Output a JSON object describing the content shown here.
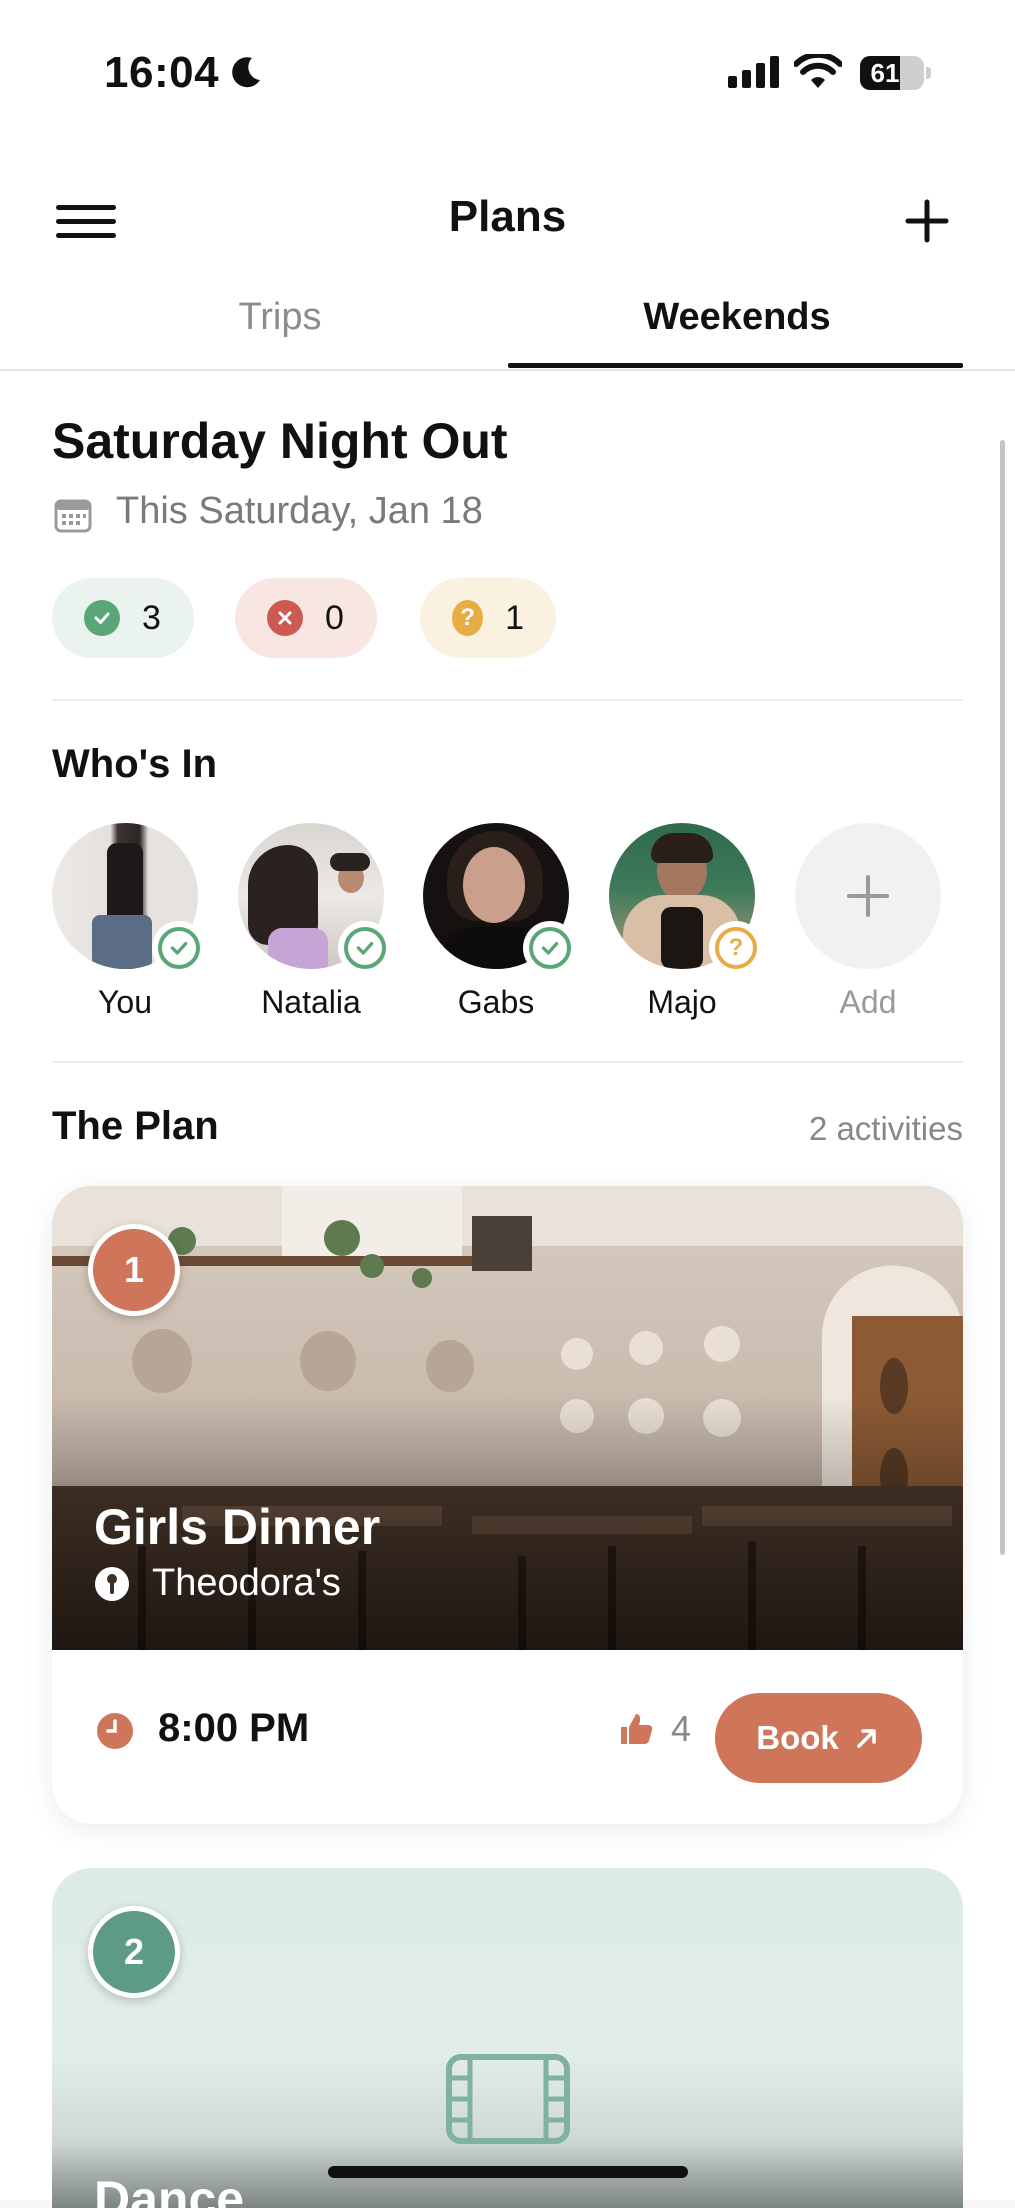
{
  "status_bar": {
    "time": "16:04",
    "battery": "61"
  },
  "header": {
    "title": "Plans"
  },
  "tabs": [
    {
      "label": "Trips",
      "active": false
    },
    {
      "label": "Weekends",
      "active": true
    }
  ],
  "event": {
    "title": "Saturday Night Out",
    "date": "This Saturday, Jan 18",
    "rsvp": {
      "yes": "3",
      "no": "0",
      "maybe": "1"
    }
  },
  "whos_in": {
    "heading": "Who's In",
    "people": [
      {
        "name": "You",
        "status": "yes"
      },
      {
        "name": "Natalia",
        "status": "yes"
      },
      {
        "name": "Gabs",
        "status": "yes"
      },
      {
        "name": "Majo",
        "status": "maybe"
      }
    ],
    "add_label": "Add"
  },
  "plan": {
    "heading": "The Plan",
    "count": "2 activities",
    "activities": [
      {
        "number": "1",
        "title": "Girls Dinner",
        "location": "Theodora's",
        "time": "8:00 PM",
        "likes": "4",
        "book_label": "Book"
      },
      {
        "number": "2",
        "title": "Dance"
      }
    ]
  },
  "colors": {
    "yes": "#5aa677",
    "no": "#cc5a52",
    "maybe": "#e6ad45",
    "accent": "#cf7559",
    "badge2": "#5e9b86"
  }
}
